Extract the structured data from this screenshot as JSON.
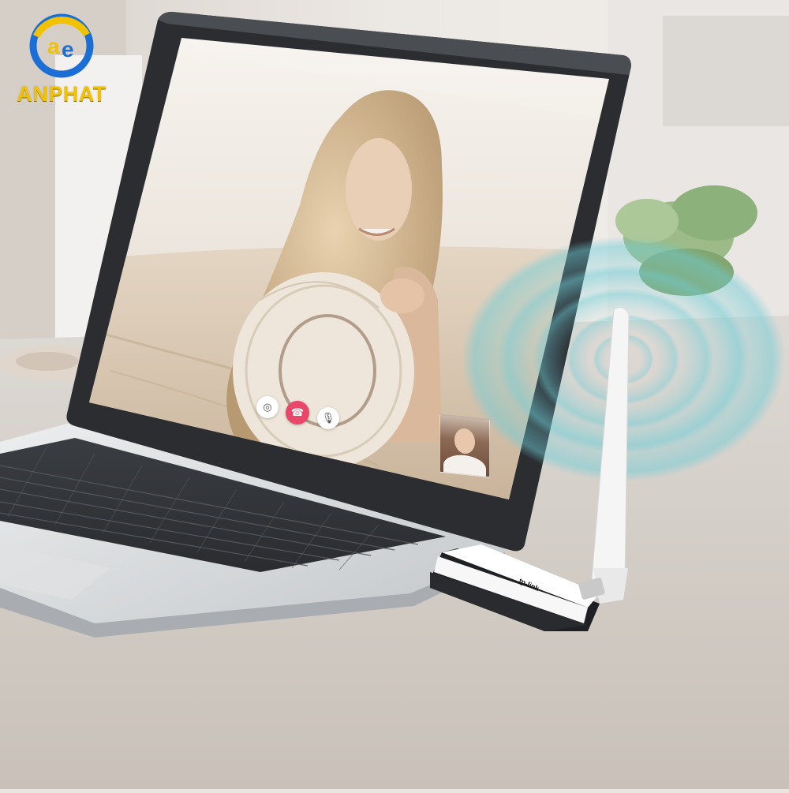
{
  "logo": {
    "text": "ANPHAT",
    "mark": "ae",
    "colors": {
      "ring": "#1a6fd6",
      "accent": "#f2c200"
    }
  },
  "screen": {
    "watermark": "",
    "call_controls": [
      {
        "name": "camera-icon",
        "glyph": "◎"
      },
      {
        "name": "hang-up-icon",
        "glyph": "☎"
      },
      {
        "name": "microphone-icon",
        "glyph": "🎙"
      }
    ],
    "hangup_color": "#e9476a"
  },
  "adapter": {
    "brand": "tp-link"
  }
}
